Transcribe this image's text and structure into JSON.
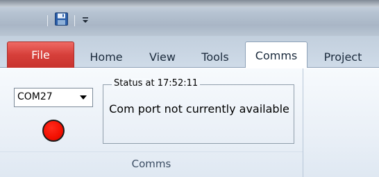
{
  "quick_access": {
    "icons": [
      "save-icon",
      "customize-menu-icon"
    ]
  },
  "tabs": [
    {
      "label": "File"
    },
    {
      "label": "Home"
    },
    {
      "label": "View"
    },
    {
      "label": "Tools"
    },
    {
      "label": "Comms"
    },
    {
      "label": "Project"
    }
  ],
  "active_tab": "Comms",
  "comms_group": {
    "label": "Comms",
    "port_select": {
      "value": "COM27"
    },
    "status_indicator": {
      "color": "#f20f00",
      "state": "disconnected"
    },
    "status": {
      "heading": "Status at 17:52:11",
      "message": "Com port not currently available"
    }
  },
  "colors": {
    "file_tab": "#d63f3a",
    "ribbon_bg": "#eaf0f7"
  }
}
